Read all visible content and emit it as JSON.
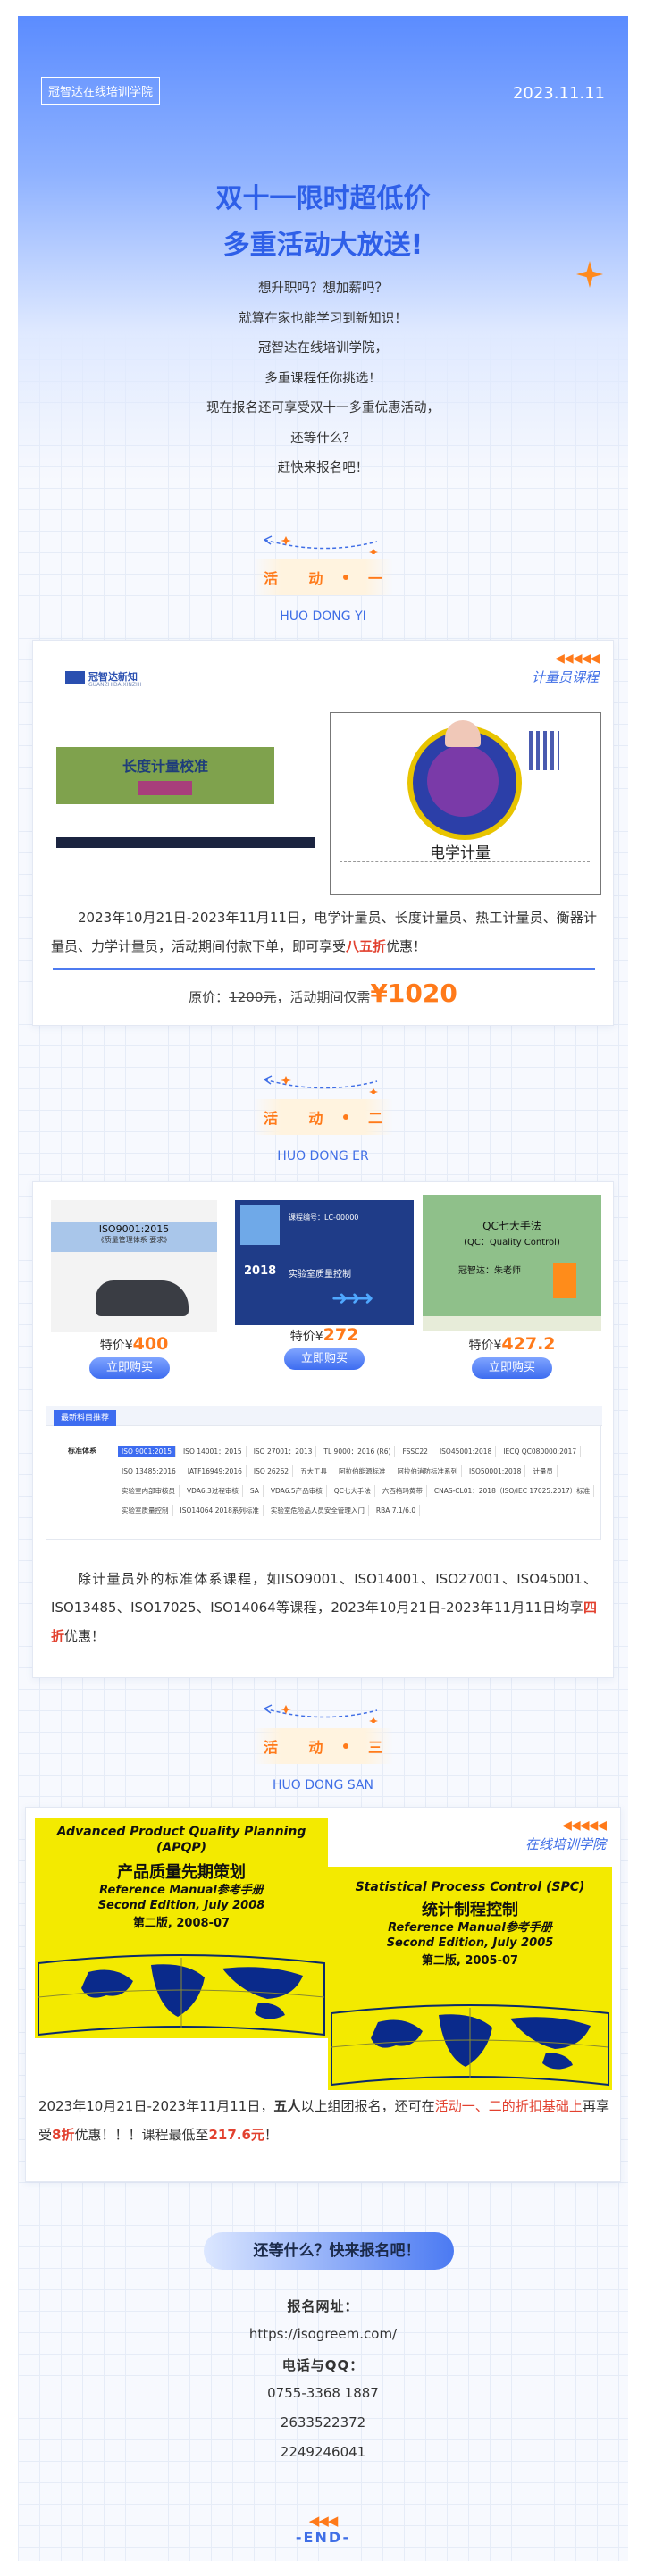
{
  "header": {
    "brand": "冠智达在线培训学院",
    "date": "2023.11.11",
    "title_line1": "双十一限时超低价",
    "title_line2": "多重活动大放送!",
    "intro": [
      "想升职吗？想加薪吗？",
      "就算在家也能学习到新知识！",
      "冠智达在线培训学院，",
      "多重课程任你挑选！",
      "现在报名还可享受双十一多重优惠活动，",
      "还等什么？",
      "赶快来报名吧！"
    ]
  },
  "section1": {
    "pill": [
      "活",
      "动",
      "一"
    ],
    "subtitle": "HUO DONG YI",
    "tag_chevrons": "◀◀◀◀◀",
    "tag_label": "计量员课程",
    "img_left": {
      "logo": "冠智达新知",
      "logo_sub": "GUANZHIDA XINZHI",
      "board_title": "长度计量校准"
    },
    "img_right": {
      "caption": "电学计量"
    },
    "desc_prefix": "2023年10月21日-2023年11月11日，电学计量员、长度计量员、热工计量员、衡器计量员、力学计量员，活动期间付款下单，即可享受",
    "desc_highlight": "八五折",
    "desc_suffix": "优惠！",
    "price_label": "原价：",
    "price_original": "1200元",
    "price_mid": "，活动期间仅需",
    "price_final": "¥1020"
  },
  "section2": {
    "pill": [
      "活",
      "动",
      "二"
    ],
    "subtitle": "HUO DONG ER",
    "products": [
      {
        "title": "ISO9001:2015",
        "sub": "《质量管理体系 要求》",
        "price_label": "特价¥",
        "price": "400",
        "button": "立即购买"
      },
      {
        "title": "实验室质量控制",
        "year": "2018",
        "code": "课程编号：LC-00000",
        "price_label": "特价¥",
        "price": "272",
        "button": "立即购买"
      },
      {
        "title": "QC七大手法",
        "sub": "(QC：Quality Control)",
        "teacher": "冠智达：朱老师",
        "price_label": "特价¥",
        "price": "427.2",
        "button": "立即购买"
      }
    ],
    "panel_tab": "最新科目推荐",
    "panel_label": "标准体系",
    "panel_rows": [
      [
        "ISO 9001:2015",
        "ISO 14001：2015",
        "ISO 27001：2013",
        "TL 9000：2016 (R6)",
        "FSSC22",
        "ISO45001:2018",
        "IECQ QC080000:2017"
      ],
      [
        "ISO 13485:2016",
        "IATF16949:2016",
        "ISO 26262",
        "五大工具",
        "阿拉伯能源标准",
        "阿拉伯消防标准系列",
        "ISO50001:2018",
        "计量员"
      ],
      [
        "实验室内部审核员",
        "VDA6.3过程审核",
        "SA",
        "VDA6.5产品审核",
        "QC七大手法",
        "六西格玛黄带",
        "CNAS-CL01：2018（ISO/IEC 17025:2017）标准"
      ],
      [
        "实验室质量控制",
        "ISO14064:2018系列标准",
        "实验室危险品人员安全管理入门",
        "RBA 7.1/6.0"
      ]
    ],
    "desc_prefix": "除计量员外的标准体系课程，如ISO9001、ISO14001、ISO27001、ISO45001、ISO13485、ISO17025、ISO14064等课程，2023年10月21日-2023年11月11日均享",
    "desc_highlight": "四折",
    "desc_suffix": "优惠！"
  },
  "section3": {
    "pill": [
      "活",
      "动",
      "三"
    ],
    "subtitle": "HUO DONG SAN",
    "tag_chevrons": "◀◀◀◀◀",
    "tag_label": "在线培训学院",
    "book_left": {
      "en": "Advanced Product Quality Planning (APQP)",
      "cn": "产品质量先期策划",
      "ref": "Reference Manual参考手册",
      "edition": "Second Edition, July 2008",
      "cn_edition": "第二版, 2008-07"
    },
    "book_right": {
      "en": "Statistical Process Control (SPC)",
      "cn": "统计制程控制",
      "ref": "Reference Manual参考手册",
      "edition": "Second Edition, July 2005",
      "cn_edition": "第二版, 2005-07"
    },
    "desc_a": "2023年10月21日-2023年11月11日，",
    "desc_b": "五人",
    "desc_c": "以上组团报名，还可在",
    "desc_d": "活动一、二的折扣基础上",
    "desc_e": "再享受",
    "desc_f": "8折",
    "desc_g": "优惠！！！课程最低至",
    "desc_h": "217.6元",
    "desc_i": "！"
  },
  "footer": {
    "cta": "还等什么？快来报名吧！",
    "url_label": "报名网址：",
    "url": "https://isogreem.com/",
    "contact_label": "电话与QQ：",
    "phone": "0755-3368 1887",
    "qq1": "2633522372",
    "qq2": "2249246041",
    "end_chevrons": "◀◀◀",
    "end": "-END-"
  },
  "colors": {
    "accent_blue": "#3f6ee6",
    "accent_orange": "#ff7a1a",
    "highlight_red": "#e2412f"
  }
}
